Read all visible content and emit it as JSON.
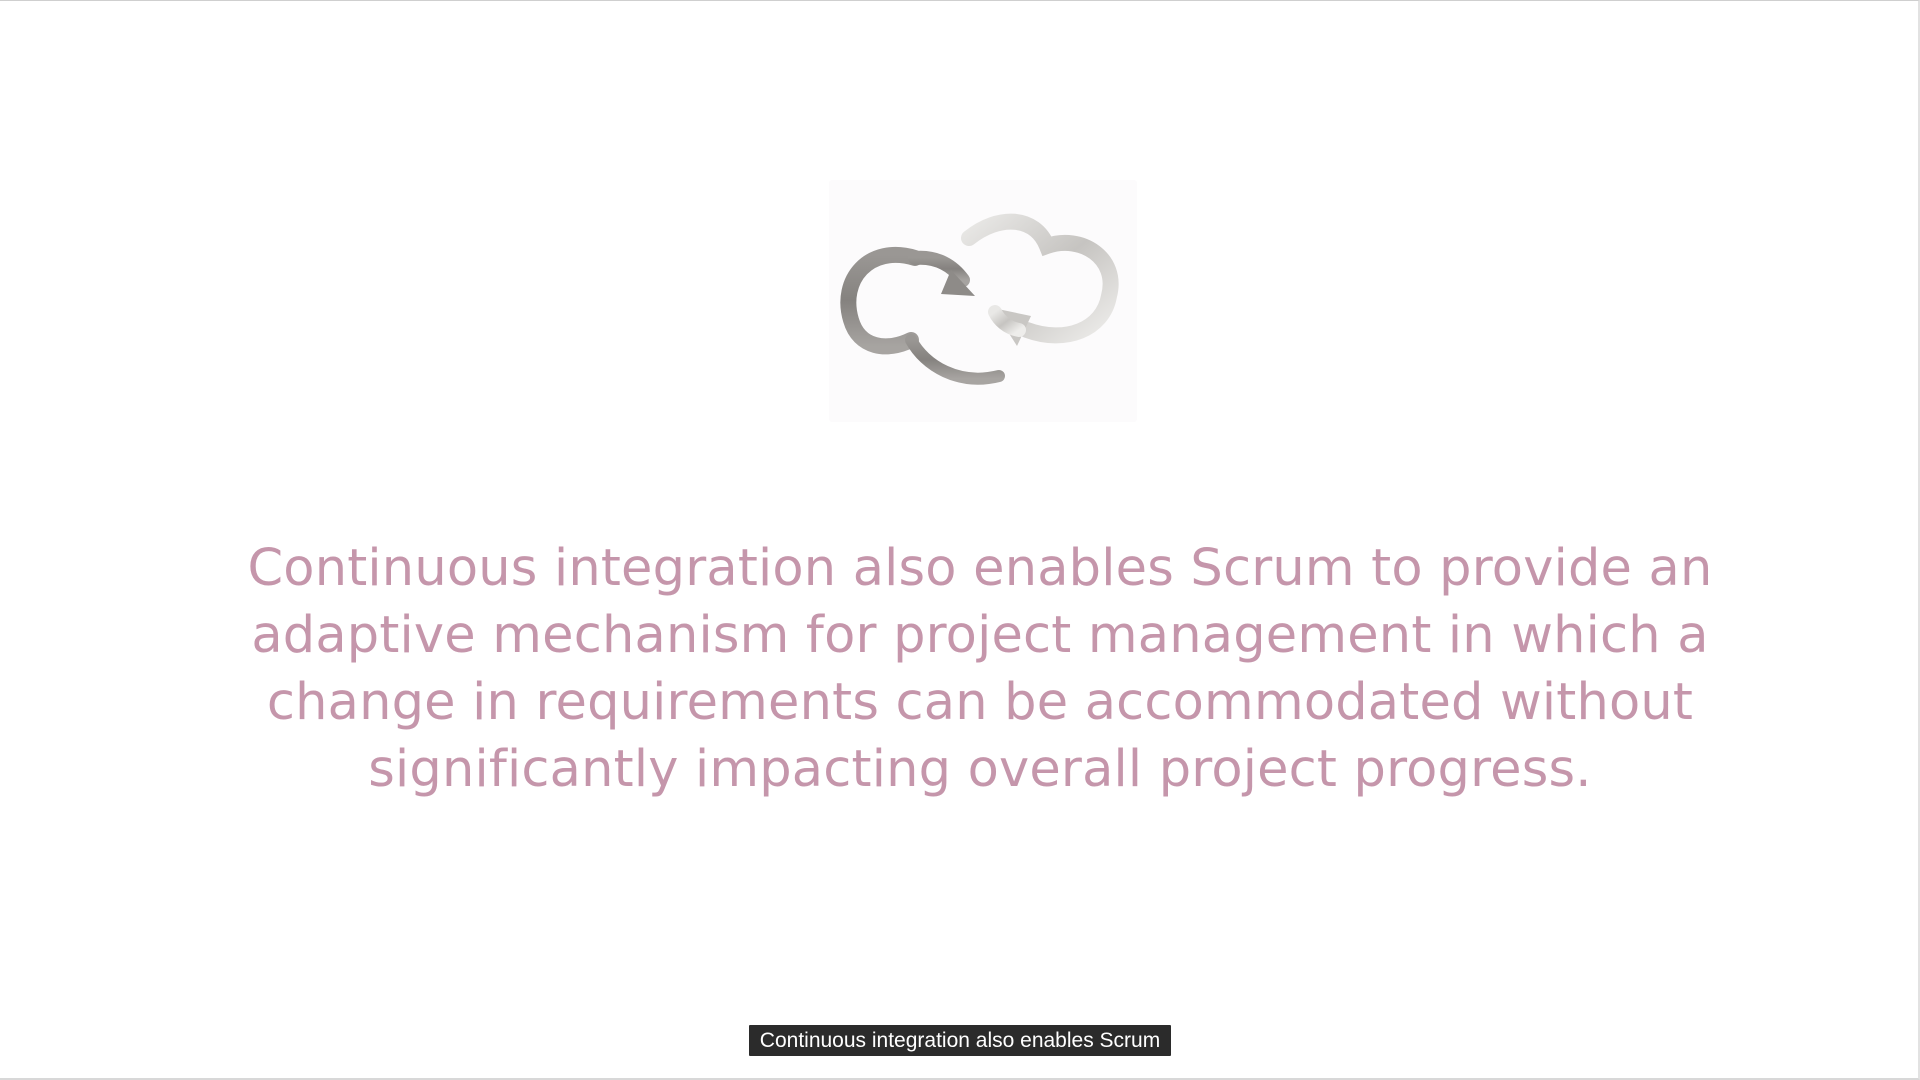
{
  "slide": {
    "logo_icon": "cycle-arrows-icon",
    "body_text": "Continuous integration also enables Scrum to provide an adaptive mechanism for project management in which a change in requirements can be accommodated without significantly impacting overall project progress.",
    "text_color": "#c596ab"
  },
  "caption": {
    "text": "Continuous integration also enables Scrum"
  }
}
